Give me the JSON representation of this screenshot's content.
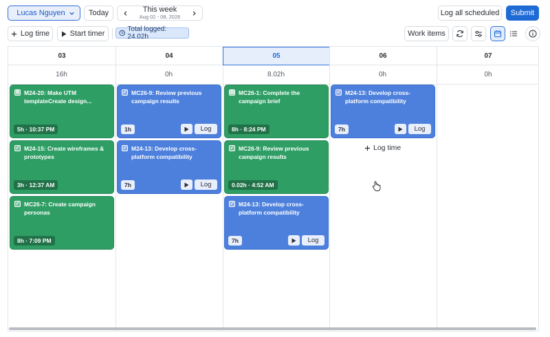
{
  "toolbar": {
    "user_name": "Lucas Nguyen",
    "today_label": "Today",
    "week_title": "This week",
    "week_range": "Aug 02 - 08, 2026",
    "log_all_label": "Log all scheduled",
    "submit_label": "Submit",
    "log_time_label": "Log time",
    "start_timer_label": "Start timer",
    "total_logged": "Total logged: 24.02h",
    "work_items_label": "Work items"
  },
  "colors": {
    "accent": "#1f6bd6",
    "green_card": "#2e9e64",
    "blue_card": "#4d80dc"
  },
  "days": [
    {
      "label": "03",
      "hours": "16h"
    },
    {
      "label": "04",
      "hours": "0h"
    },
    {
      "label": "05",
      "hours": "8.02h",
      "active": true
    },
    {
      "label": "06",
      "hours": "0h"
    },
    {
      "label": "07",
      "hours": "0h"
    }
  ],
  "cards": [
    {
      "day": 0,
      "title": "M24-20: Make UTM templateCreate design...",
      "meta": "5h · 10:37 PM",
      "icon": "subtask-icon",
      "kind": "logged"
    },
    {
      "day": 0,
      "title": "M24-15: Create wireframes & prototypes",
      "meta": "3h · 12:37 AM",
      "icon": "checkbox-icon",
      "kind": "logged"
    },
    {
      "day": 0,
      "title": "MC26-7: Create campaign personas",
      "meta": "8h · 7:09 PM",
      "icon": "checkbox-icon",
      "kind": "logged"
    },
    {
      "day": 1,
      "title": "MC26-9: Review previous campaign results",
      "meta": "1h",
      "icon": "checkbox-icon",
      "kind": "scheduled",
      "log_label": "Log"
    },
    {
      "day": 1,
      "title": "M24-13: Develop cross-platform compatibility",
      "meta": "7h",
      "icon": "checkbox-icon",
      "kind": "scheduled",
      "log_label": "Log"
    },
    {
      "day": 2,
      "title": "MC26-1: Complete the campaign brief",
      "meta": "8h · 8:24 PM",
      "icon": "story-icon",
      "kind": "logged"
    },
    {
      "day": 2,
      "title": "MC26-9: Review previous campaign results",
      "meta": "0.02h · 4:52 AM",
      "icon": "checkbox-icon",
      "kind": "logged"
    },
    {
      "day": 2,
      "title": "M24-13: Develop cross-platform compatibility",
      "meta": "7h",
      "icon": "checkbox-icon",
      "kind": "scheduled",
      "log_label": "Log"
    },
    {
      "day": 3,
      "title": "M24-13: Develop cross-platform compatibility",
      "meta": "7h",
      "icon": "checkbox-icon",
      "kind": "scheduled",
      "log_label": "Log"
    }
  ],
  "add_log_time_label": "Log time"
}
